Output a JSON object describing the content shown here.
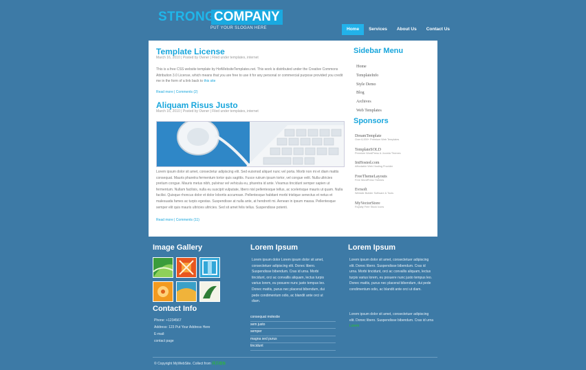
{
  "header": {
    "logo_strong": "STRONG",
    "logo_company": "COMPANY",
    "slogan": "PUT YOUR SLOGAN HERE",
    "nav": [
      "Home",
      "Services",
      "About Us",
      "Contact Us"
    ],
    "active_nav": "Home"
  },
  "posts": [
    {
      "title": "Template License",
      "meta": "March 16, 2010 | Posted by Owner | Filed under templates, internet",
      "body": "This is a free CSS website template by HotWebsiteTemplates.net. This work is distributed under the Creative Commons Attribution 3.0 License, which means that you are free to use it for any personal or commercial purpose provided you credit me in the form of a link back to",
      "body_link": "this site",
      "read_more": "Read more | Comments (2)"
    },
    {
      "title": "Aliquam Risus Justo",
      "meta": "March 16, 2010 | Posted by Owner | Filed under templates, internet",
      "body": "Lorem ipsum dolor sit amet, consectetur adipiscing elit. Sed euismod aliquet nunc vel porta. Morbi non mi et diam mattis consequat. Mauris pharetra fermentum tortor quis sagittis. Fusce rutrum ipsum tortor, vel congue velit. Nulla ultricies pretium congue. Mauris metus nibh, pulvinar vel vehicula eu, pharetra id ante. Vivamus tincidunt semper sapien ut fermentum. Nullam facilisis, nulla eu suscipit vulputate, libero nisl pellentesque tellus, ac scelerisque mauris ut quam. Nulla facilisi. Quisque rhoncus dolor et dolor lobortis accumsan. Pellentesque habitant morbi tristique senectus et netus et malesuada fames ac turpis egestas. Suspendisse at nulla ante, at hendrerit mi. Aenean in ipsum massa. Pellentesque semper elit quis mauris ultricies ultricies. Sed sit amet felis tellus. Suspendisse potenti.",
      "read_more": "Read more | Comments (11)"
    }
  ],
  "sidebar": {
    "menu_title": "Sidebar Menu",
    "menu": [
      "Home",
      "TemplateInfo",
      "Style Demo",
      "Blog",
      "Archives",
      "Web Templates"
    ],
    "sponsors_title": "Sponsors",
    "sponsors": [
      {
        "name": "DreamTemplate",
        "desc": "Over 6,000+ Premium Web Templates"
      },
      {
        "name": "TemplateSOLD",
        "desc": "Premium WordPress & Joomla Themes"
      },
      {
        "name": "ImHosted.com",
        "desc": "Affordable Web Hosting Provider"
      },
      {
        "name": "FreeThemeLayouts",
        "desc": "Free WordPress Themes"
      },
      {
        "name": "Evrsoft",
        "desc": "Website Builder Software & Tools"
      },
      {
        "name": "MyVectorStore",
        "desc": "Royalty Free Stock Icons"
      }
    ]
  },
  "bottom": {
    "gallery_title": "Image Gallery",
    "gallery_colors": [
      "#3b9c3b",
      "#e8561f",
      "#32a7d8",
      "#f29a1f",
      "#f0b33a",
      "#2e7d35"
    ],
    "contact_title": "Contact Info",
    "contact_lines": [
      "Phone: +1234567",
      "Address: 123 Put Your Address Here",
      "E-mail:",
      "contact page"
    ],
    "col2_title": "Lorem Ipsum",
    "col2_text": "Lorem ipsum dolor Lorem ipsum dolor sit amet, consectetuer adipiscing elit. Donec libero. Suspendisse bibendum. Cras id urna. Morbi tincidunt, orci ac convallis aliquam, lectus turpis varius lorem, eu posuere nunc justo tempus leo. Donec mattis, purus nec placerat bibendum, dui pede condimentum odio, ac blandit ante orci ut diam.",
    "col2_list": [
      "consequat molestie",
      "sem justo",
      "semper",
      "magna sed purus",
      "tincidunt"
    ],
    "col3_title": "Lorem Ipsum",
    "col3_text": "Lorem ipsum dolor sit amet, consectetuer adipiscing elit. Donec libero. Suspendisse bibendum. Cras id urna. Morbi tincidunt, orci ac convallis aliquam, lectus turpis varius lorem, eu posuere nunc justo tempus leo. Donec mattis, purus nec placerat bibendum, dui pede condimentum odio, ac blandit ante orci ut diam.",
    "col3_text2": "Lorem ipsum dolor sit amet, consectetuer adipiscing elit. Donec libero. Suspendisse bibendum. Cras id urna",
    "col3_link": "Lorem"
  },
  "footer": {
    "text": "© Copyright MyWebSite. Collect from",
    "link": "网页模板"
  },
  "colors": {
    "background": "#3d7aa6",
    "accent": "#18a6dc",
    "content_bg": "#ffffff"
  }
}
